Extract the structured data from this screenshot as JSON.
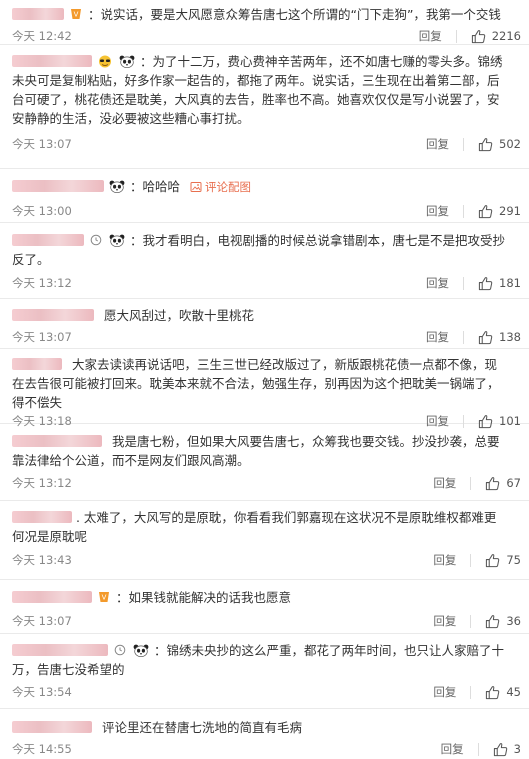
{
  "ui": {
    "reply_label": "回复",
    "report_label": "评论配图"
  },
  "comments": [
    {
      "text": "：说实话，要是大风愿意众筹告唐七这个所谓的“门下走狗”，我第一个交钱",
      "time": "今天 12:42",
      "likes": "2216"
    },
    {
      "text": "：为了十二万，费心费神辛苦两年，还不如唐七赚的零头多。锦绣未央可是复制粘贴，好多作家一起告的，都拖了两年。说实话，三生现在出着第二部，后台可硬了，桃花债还是耽美，大风真的去告，胜率也不高。她喜欢仅仅是写小说罢了，安安静静的生活，没必要被这些糟心事打扰。",
      "time": "今天 13:07",
      "likes": "502"
    },
    {
      "text": "：哈哈哈",
      "time": "今天 13:00",
      "likes": "291"
    },
    {
      "text": "：我才看明白，电视剧播的时候总说拿错剧本，唐七是不是把攻受抄反了。",
      "time": "今天 13:12",
      "likes": "181"
    },
    {
      "text": "愿大风刮过，吹散十里桃花",
      "time": "今天 13:07",
      "likes": "138"
    },
    {
      "text": "大家去读读再说话吧，三生三世已经改版过了，新版跟桃花债一点都不像，现在去告很可能被打回来。耽美本来就不合法，勉强生存，别再因为这个把耽美一锅端了，得不偿失",
      "time": "今天 13:18",
      "likes": "101"
    },
    {
      "text": "我是唐七粉，但如果大风要告唐七，众筹我也要交钱。抄没抄袭，总要靠法律给个公道，而不是网友们跟风高潮。",
      "time": "今天 13:12",
      "likes": "67"
    },
    {
      "text": ". 太难了，大风写的是原耽，你看看我们郭嘉现在这状况不是原耽维权都难更何况是原耽呢",
      "time": "今天 13:43",
      "likes": "75"
    },
    {
      "text": "：如果钱就能解决的话我也愿意",
      "time": "今天 13:07",
      "likes": "36"
    },
    {
      "text": "：锦绣未央抄的这么严重，都花了两年时间，也只让人家赔了十万，告唐七没希望的",
      "time": "今天 13:54",
      "likes": "45"
    },
    {
      "text": "评论里还在替唐七洗地的简直有毛病",
      "time": "今天 14:55",
      "likes": "3"
    }
  ],
  "icons": {
    "like": "thumbs-up-icon",
    "report": "image-icon",
    "badge": "level-badge-icon",
    "emoji": "panda-emoji-icon",
    "clock": "clock-badge-icon"
  },
  "colors": {
    "report": "#e86f4f",
    "meta": "#888888",
    "divider": "#eaeaea"
  }
}
